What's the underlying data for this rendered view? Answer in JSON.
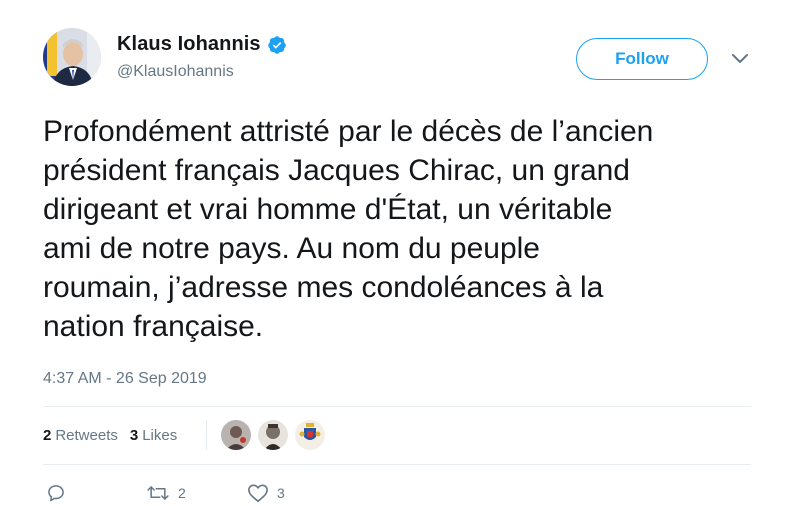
{
  "author": {
    "display_name": "Klaus Iohannis",
    "handle": "@KlausIohannis",
    "verified": true
  },
  "follow_label": "Follow",
  "tweet": {
    "text": "Profondément attristé par le décès de l’ancien\nprésident français Jacques Chirac, un grand\ndirigeant et vrai homme d'État, un véritable\nami de notre pays. Au nom du peuple\nroumain, j’adresse mes condoléances à la\nnation française.",
    "timestamp": "4:37 AM - 26 Sep 2019"
  },
  "stats": {
    "retweets_count": "2",
    "retweets_label": "Retweets",
    "likes_count": "3",
    "likes_label": "Likes"
  },
  "actions": {
    "reply_count": "",
    "retweet_count": "2",
    "like_count": "3"
  },
  "icons": [
    "verified-badge-icon",
    "chevron-down-icon",
    "reply-icon",
    "retweet-icon",
    "heart-icon"
  ],
  "colors": {
    "accent": "#1da1f2",
    "text": "#14171a",
    "muted": "#657786",
    "divider": "#e6ecf0"
  }
}
